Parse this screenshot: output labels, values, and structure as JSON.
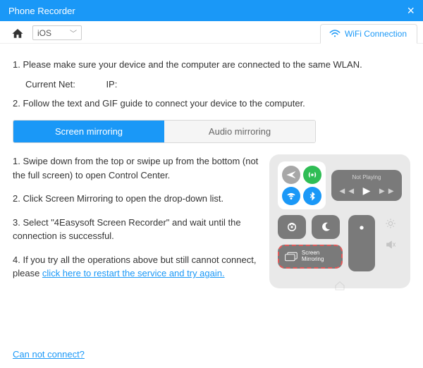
{
  "titlebar": {
    "title": "Phone Recorder"
  },
  "topbar": {
    "platform": "iOS",
    "wifi_tab": "WiFi Connection"
  },
  "steps": {
    "s1": "1. Please make sure your device and the computer are connected to the same WLAN.",
    "current_net_label": "Current Net:",
    "ip_label": "IP:",
    "s2": "2. Follow the text and GIF guide to connect your device to the computer."
  },
  "tabs": {
    "screen": "Screen mirroring",
    "audio": "Audio mirroring"
  },
  "instructions": {
    "i1": "1. Swipe down from the top or swipe up from the bottom (not the full screen) to open Control Center.",
    "i2": "2. Click Screen Mirroring to open the drop-down list.",
    "i3": "3. Select \"4Easysoft Screen Recorder\" and wait until the connection is successful.",
    "i4_a": "4. If you try all the operations above but still cannot connect, please ",
    "i4_link": "click here to restart the service and try again."
  },
  "phone": {
    "not_playing": "Not Playing",
    "screen_mirroring": "Screen Mirroring"
  },
  "footer": {
    "cannot_connect": "Can not connect?"
  }
}
